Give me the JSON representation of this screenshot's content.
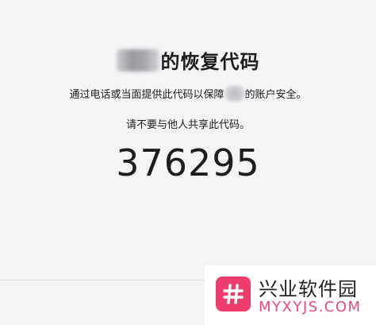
{
  "recovery": {
    "title": "的恢复代码",
    "line1_prefix": "通过电话或当面提供此代码以保障",
    "line1_suffix": "的账户安全。",
    "line2": "请不要与他人共享此代码。",
    "code": "376295"
  },
  "watermark": {
    "cn": "兴业软件园",
    "en": "MYXYJS.COM",
    "logo_color": "#ef3d6e"
  }
}
